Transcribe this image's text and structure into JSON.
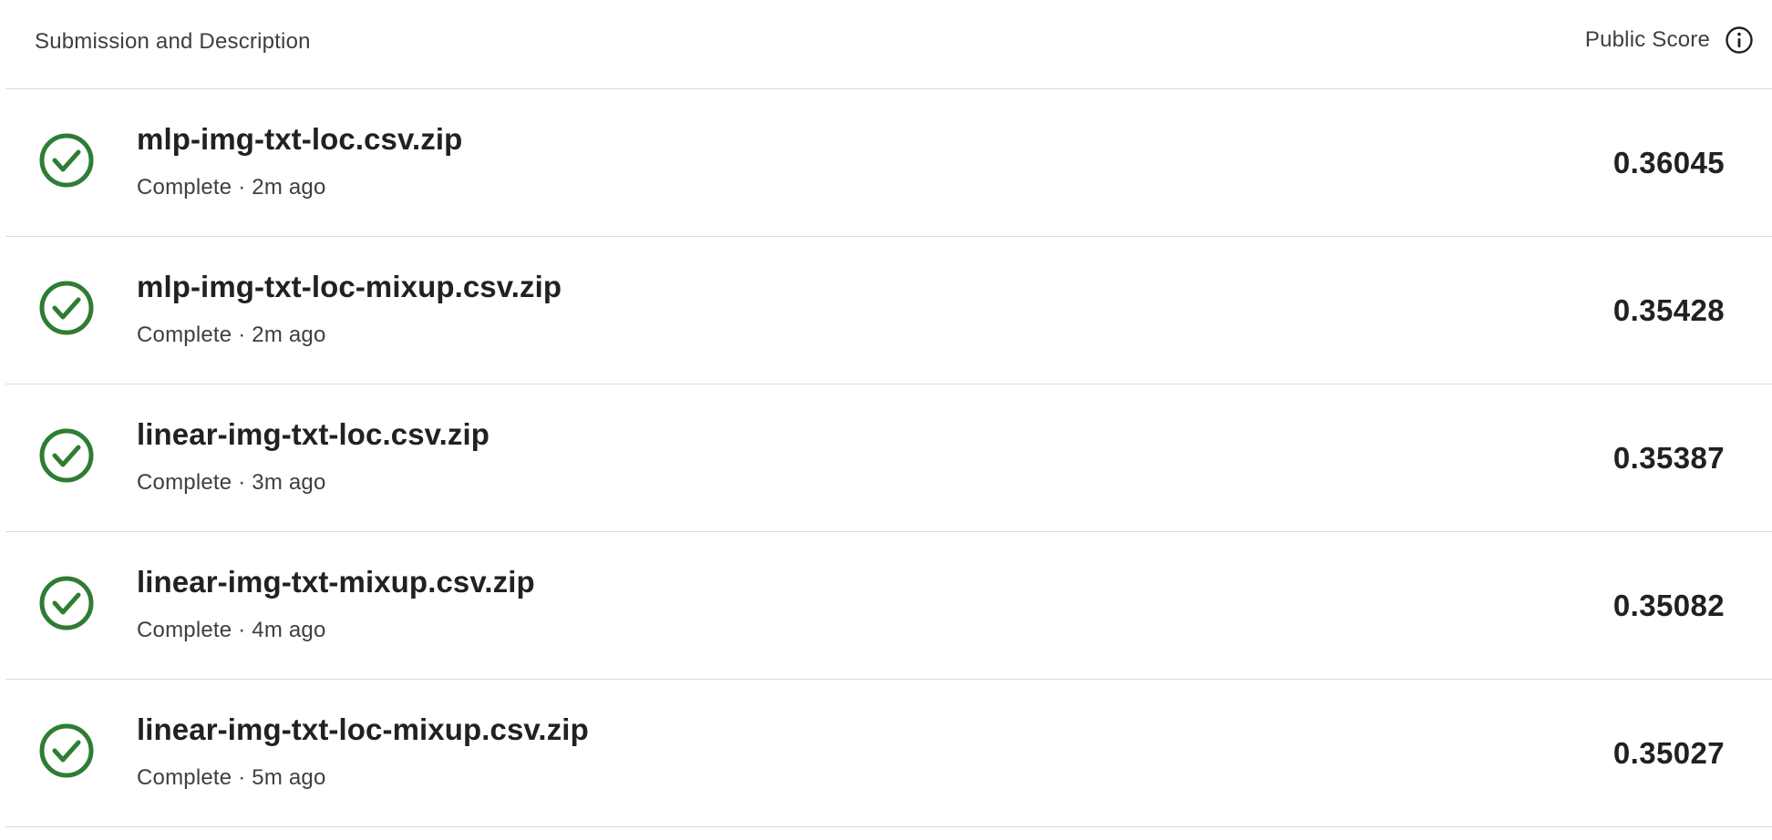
{
  "header": {
    "left_label": "Submission and Description",
    "right_label": "Public Score",
    "info_icon": "info-icon"
  },
  "colors": {
    "status_complete": "#2e7d32",
    "divider": "#dadce0",
    "text_primary": "#202124",
    "text_secondary": "#3c4043"
  },
  "rows": [
    {
      "name": "mlp-img-txt-loc.csv.zip",
      "status": "Complete",
      "separator": "·",
      "time": "2m ago",
      "score": "0.36045",
      "icon": "check-circle-icon"
    },
    {
      "name": "mlp-img-txt-loc-mixup.csv.zip",
      "status": "Complete",
      "separator": "·",
      "time": "2m ago",
      "score": "0.35428",
      "icon": "check-circle-icon"
    },
    {
      "name": "linear-img-txt-loc.csv.zip",
      "status": "Complete",
      "separator": "·",
      "time": "3m ago",
      "score": "0.35387",
      "icon": "check-circle-icon"
    },
    {
      "name": "linear-img-txt-mixup.csv.zip",
      "status": "Complete",
      "separator": "·",
      "time": "4m ago",
      "score": "0.35082",
      "icon": "check-circle-icon"
    },
    {
      "name": "linear-img-txt-loc-mixup.csv.zip",
      "status": "Complete",
      "separator": "·",
      "time": "5m ago",
      "score": "0.35027",
      "icon": "check-circle-icon"
    }
  ]
}
